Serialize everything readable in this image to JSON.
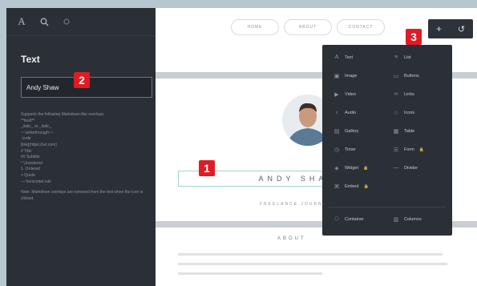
{
  "sidebar": {
    "title": "Text",
    "name_input_value": "Andy Shaw",
    "help_lines": [
      "Supports the following Markdown-like overlays:",
      "**bold**",
      "_italic_ or _italic_",
      "~~strikethrough~~",
      "`code`",
      "[link](https://url.com)",
      "# Title",
      "## Subtitle",
      "* Unordered",
      "1. Ordered",
      "> Quote",
      "--- horizontal rule"
    ],
    "note": "Note: Markdown overlays are removed from the text when the icon is clicked."
  },
  "nav": {
    "items": [
      "HOME",
      "ABOUT",
      "CONTACT"
    ]
  },
  "page": {
    "name": "ANDY SHAW",
    "tagline": "FREELANCE JOURNALIST",
    "section": "ABOUT"
  },
  "menu": {
    "left": [
      {
        "icon": "text-icon",
        "glyph": "A",
        "label": "Text"
      },
      {
        "icon": "image-icon",
        "glyph": "▣",
        "label": "Image"
      },
      {
        "icon": "video-icon",
        "glyph": "▶",
        "label": "Video"
      },
      {
        "icon": "audio-icon",
        "glyph": "♪",
        "label": "Audio"
      },
      {
        "icon": "gallery-icon",
        "glyph": "▤",
        "label": "Gallery"
      },
      {
        "icon": "timer-icon",
        "glyph": "◷",
        "label": "Timer"
      },
      {
        "icon": "widget-icon",
        "glyph": "◈",
        "label": "Widget"
      },
      {
        "icon": "embed-icon",
        "glyph": "⌘",
        "label": "Embed"
      }
    ],
    "right": [
      {
        "icon": "list-icon",
        "glyph": "≡",
        "label": "List"
      },
      {
        "icon": "buttons-icon",
        "glyph": "▭",
        "label": "Buttons"
      },
      {
        "icon": "links-icon",
        "glyph": "∞",
        "label": "Links"
      },
      {
        "icon": "icons-icon",
        "glyph": "☆",
        "label": "Icons"
      },
      {
        "icon": "table-icon",
        "glyph": "▦",
        "label": "Table"
      },
      {
        "icon": "form-icon",
        "glyph": "☰",
        "label": "Form"
      },
      {
        "icon": "divider-icon",
        "glyph": "—",
        "label": "Divider"
      }
    ],
    "footer": [
      {
        "icon": "container-icon",
        "glyph": "□",
        "label": "Container"
      },
      {
        "icon": "columns-icon",
        "glyph": "▥",
        "label": "Columns"
      }
    ]
  },
  "badges": [
    "1",
    "2",
    "3"
  ],
  "colors": {
    "accent": "#e01b24",
    "highlight": "#9fd6d1",
    "lock": "#e3c02f"
  }
}
